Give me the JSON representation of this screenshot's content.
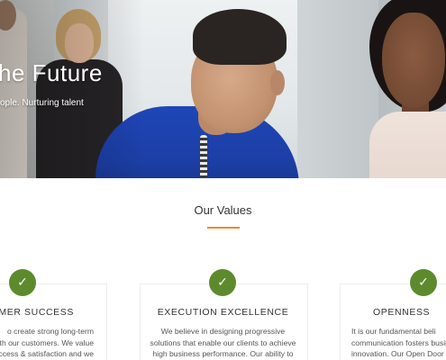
{
  "hero": {
    "title": "he Future",
    "subtitle": "ople. Nurturing talent"
  },
  "values": {
    "title": "Our Values",
    "accent_color": "#e88a2a",
    "badge_color": "#5e8a2e",
    "badge_icon": "check-icon",
    "badge_glyph": "✓",
    "cards": [
      {
        "title": "OMER SUCCESS",
        "lines": [
          "o create strong long-term",
          "with our customers. We value",
          "ccess & satisfaction and we"
        ]
      },
      {
        "title": "EXECUTION EXCELLENCE",
        "lines": [
          "We believe in designing progressive",
          "solutions that enable our clients to achieve",
          "high business performance. Our ability to"
        ]
      },
      {
        "title": "OPENNESS",
        "lines": [
          "It is our fundamental beli",
          "communication fosters busin",
          "innovation. Our Open Door"
        ]
      }
    ]
  }
}
